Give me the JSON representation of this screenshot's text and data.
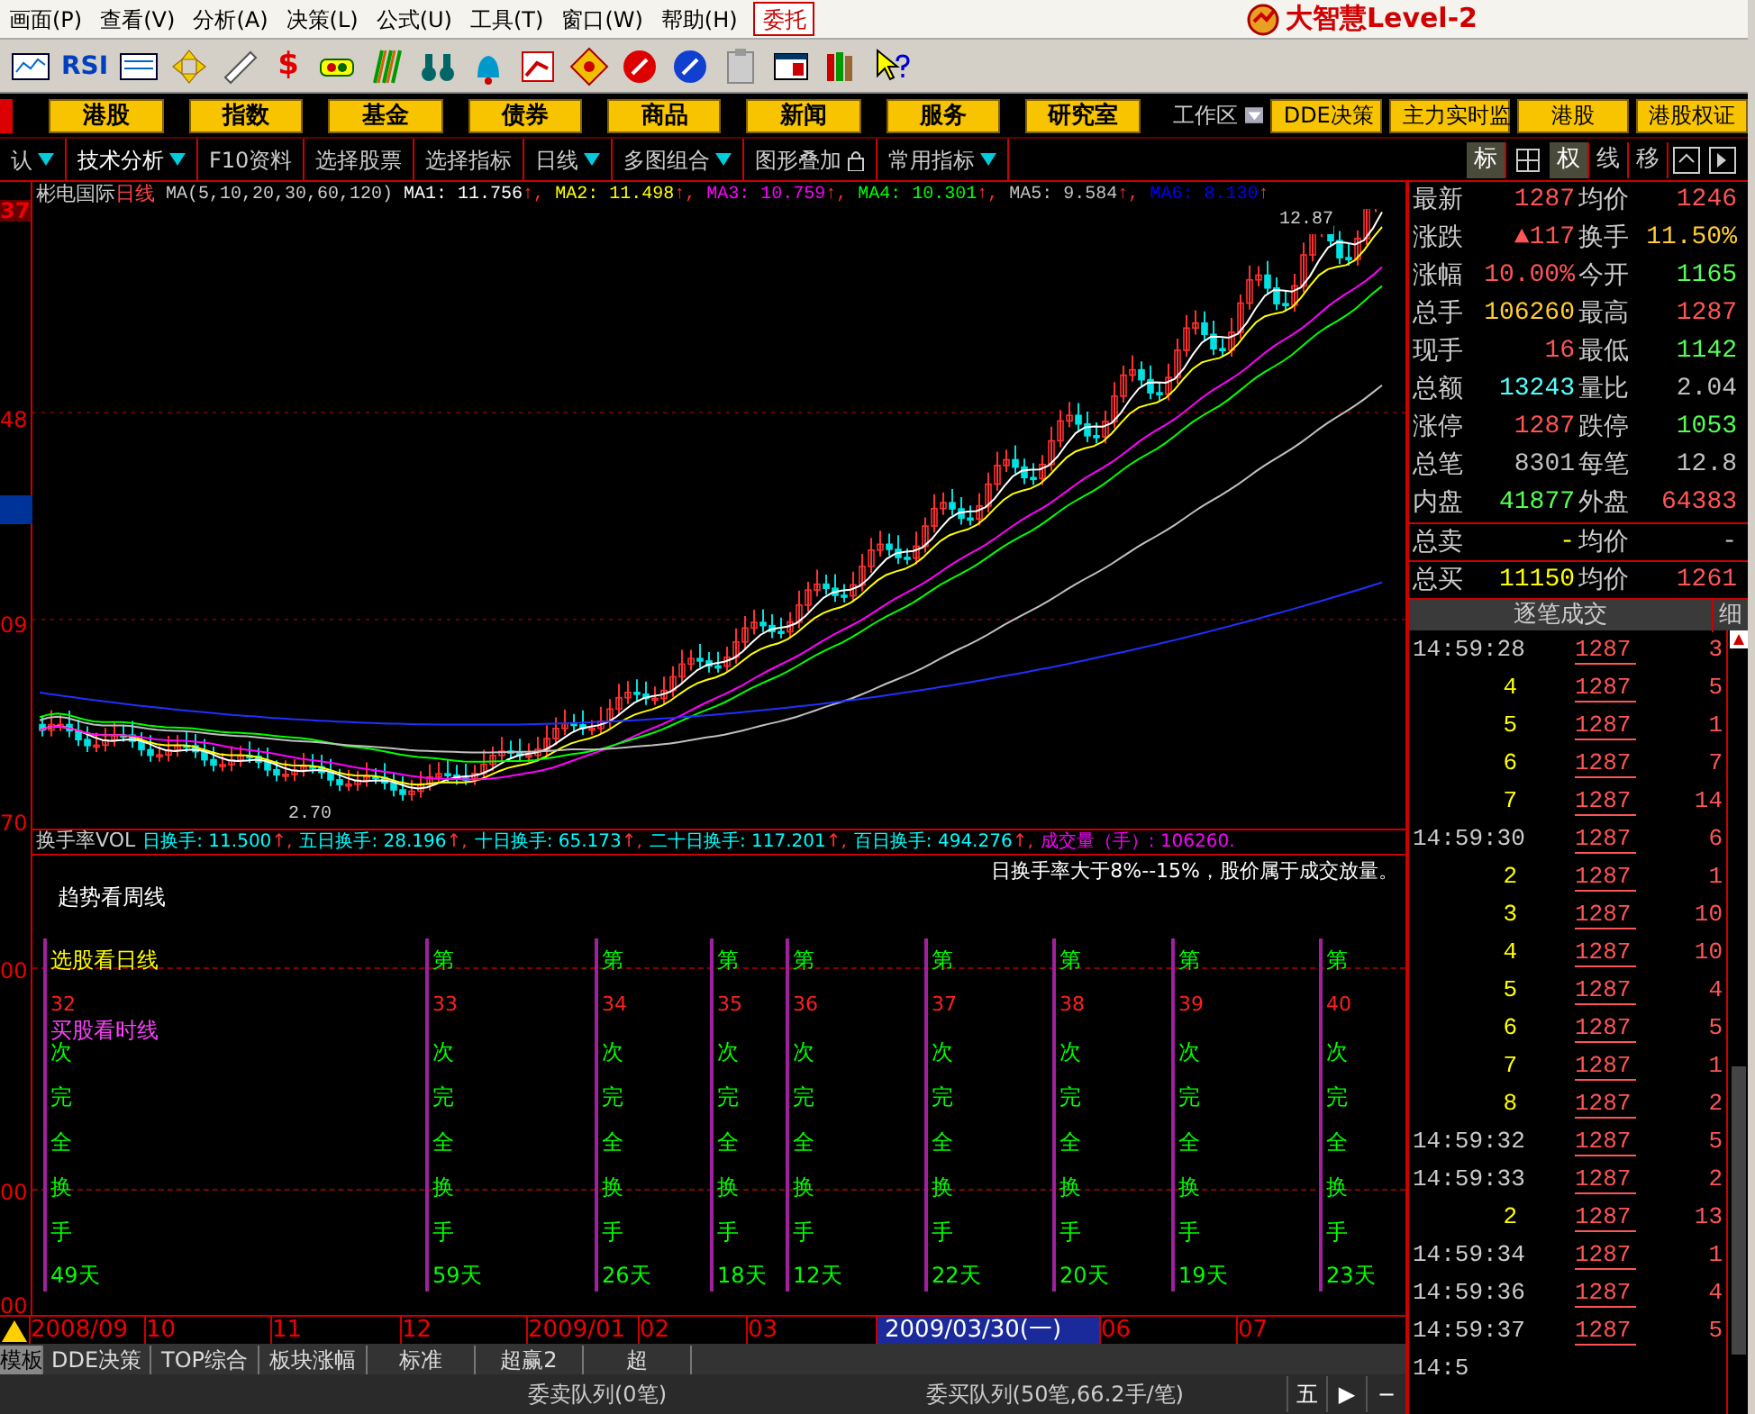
{
  "menu": [
    {
      "label": "画面(P)"
    },
    {
      "label": "查看(V)"
    },
    {
      "label": "分析(A)"
    },
    {
      "label": "决策(L)"
    },
    {
      "label": "公式(U)"
    },
    {
      "label": "工具(T)"
    },
    {
      "label": "窗口(W)"
    },
    {
      "label": "帮助(H)"
    }
  ],
  "trade_button": "委托",
  "brand": "大智慧Level-2",
  "toolbar": {
    "rsi_label": "RSI",
    "dollar_label": "$"
  },
  "nav_buttons": [
    "港股",
    "指数",
    "基金",
    "债券",
    "商品",
    "新闻",
    "服务",
    "研究室"
  ],
  "workspace": "工作区",
  "nav_right": [
    "DDE决策",
    "主力实时监",
    "港股",
    "港股权证"
  ],
  "tool_tabs": [
    {
      "label": "认",
      "dropdown": true
    },
    {
      "label": "技术分析",
      "dropdown": true
    },
    {
      "label": "F10资料",
      "dropdown": false
    },
    {
      "label": "选择股票",
      "dropdown": false
    },
    {
      "label": "选择指标",
      "dropdown": false
    },
    {
      "label": "日线",
      "dropdown": true
    },
    {
      "label": "多图组合",
      "dropdown": true
    },
    {
      "label": "图形叠加",
      "dropdown": false
    },
    {
      "label": "常用指标",
      "dropdown": true
    }
  ],
  "view_buttons": [
    {
      "label": "标",
      "selected": true
    },
    {
      "label": "权",
      "selected": true
    },
    {
      "label": "线",
      "selected": false
    },
    {
      "label": "移",
      "selected": false
    }
  ],
  "chart": {
    "stock": "彬电国际",
    "period": "日线",
    "ma_params": "MA(5,10,20,30,60,120)",
    "ma": [
      {
        "label": "MA1: 11.756",
        "suffix": "↑,",
        "color": "#ffffff"
      },
      {
        "label": "MA2: 11.498",
        "suffix": "↑,",
        "color": "#ffff00"
      },
      {
        "label": "MA3: 10.759",
        "suffix": "↑,",
        "color": "#ff00ff"
      },
      {
        "label": "MA4: 10.301",
        "suffix": "↑,",
        "color": "#00ff00"
      },
      {
        "label": "MA5: 9.584",
        "suffix": "↑,",
        "color": "#c0c0c0"
      },
      {
        "label": "MA6: 8.130",
        "suffix": "↑",
        "color": "#0000ff"
      }
    ],
    "high_label": "12.87",
    "low_label": "2.70",
    "axis_labels": [
      "37",
      "48",
      "09",
      "70"
    ]
  },
  "indicator": {
    "name": "换手率VOL",
    "values": [
      {
        "label": "日换手: 11.500",
        "suffix": "↑,",
        "color": "#00ffff"
      },
      {
        "label": "五日换手: 28.196",
        "suffix": "↑,",
        "color": "#00ffff"
      },
      {
        "label": "十日换手: 65.173",
        "suffix": "↑,",
        "color": "#00ffff"
      },
      {
        "label": "二十日换手: 117.201",
        "suffix": "↑,",
        "color": "#00ffff"
      },
      {
        "label": "百日换手: 494.276",
        "suffix": "↑,",
        "color": "#00ffff"
      },
      {
        "label": "成交量（手）: 106260.",
        "color": "#ff00ff"
      }
    ],
    "note": "日换手率大于8%--15%，股价属于成交放量。",
    "trend": "趋势看周线",
    "axis_labels": [
      "00",
      "00",
      "00"
    ],
    "columns": [
      {
        "head": "选股看日线",
        "num": "32",
        "sub": "买股看时线",
        "chars": [
          "次",
          "完",
          "全",
          "换",
          "手"
        ],
        "days": "49天"
      },
      {
        "head": "第",
        "num": "33",
        "chars": [
          "次",
          "完",
          "全",
          "换",
          "手"
        ],
        "days": "59天"
      },
      {
        "head": "第",
        "num": "34",
        "chars": [
          "次",
          "完",
          "全",
          "换",
          "手"
        ],
        "days": "26天"
      },
      {
        "head": "第",
        "num": "35",
        "chars": [
          "次",
          "完",
          "全",
          "换",
          "手"
        ],
        "days": "18天"
      },
      {
        "head": "第",
        "num": "36",
        "chars": [
          "次",
          "完",
          "全",
          "换",
          "手"
        ],
        "days": "12天"
      },
      {
        "head": "第",
        "num": "37",
        "chars": [
          "次",
          "完",
          "全",
          "换",
          "手"
        ],
        "days": "22天"
      },
      {
        "head": "第",
        "num": "38",
        "chars": [
          "次",
          "完",
          "全",
          "换",
          "手"
        ],
        "days": "20天"
      },
      {
        "head": "第",
        "num": "39",
        "chars": [
          "次",
          "完",
          "全",
          "换",
          "手"
        ],
        "days": "19天"
      },
      {
        "head": "第",
        "num": "40",
        "chars": [
          "次",
          "完",
          "全",
          "换",
          "手"
        ],
        "days": "23天"
      }
    ]
  },
  "dates": [
    {
      "label": "2008/09",
      "selected": false
    },
    {
      "label": "10",
      "selected": false
    },
    {
      "label": "11",
      "selected": false
    },
    {
      "label": "12",
      "selected": false
    },
    {
      "label": "2009/01",
      "selected": false
    },
    {
      "label": "02",
      "selected": false
    },
    {
      "label": "03",
      "selected": false
    },
    {
      "label": "2009/03/30(一)",
      "selected": true
    },
    {
      "label": "06",
      "selected": false
    },
    {
      "label": "07",
      "selected": false
    }
  ],
  "bottom_tabs": [
    {
      "label": "模板",
      "selected": true
    },
    {
      "label": "DDE决策",
      "selected": false
    },
    {
      "label": "TOP综合",
      "selected": false
    },
    {
      "label": "板块涨幅",
      "selected": false
    },
    {
      "label": "标准",
      "selected": false
    },
    {
      "label": "超赢2",
      "selected": false
    },
    {
      "label": "超",
      "selected": false
    }
  ],
  "status": {
    "sell_queue": "委卖队列(0笔)",
    "buy_queue": "委买队列(50笔,66.2手/笔)",
    "five": "五",
    "play": "▶",
    "minus": "−"
  },
  "quote": [
    {
      "cells": [
        {
          "label": "最新",
          "value": "1287",
          "color": "#ff5555"
        },
        {
          "label": "均价",
          "value": "1246",
          "color": "#ff5555"
        }
      ]
    },
    {
      "cells": [
        {
          "label": "涨跌",
          "value": "▲117",
          "color": "#ff5555"
        },
        {
          "label": "换手",
          "value": "11.50%",
          "color": "#ffcc33"
        }
      ]
    },
    {
      "cells": [
        {
          "label": "涨幅",
          "value": "10.00%",
          "color": "#ff5555"
        },
        {
          "label": "今开",
          "value": "1165",
          "color": "#55ff55"
        }
      ]
    },
    {
      "cells": [
        {
          "label": "总手",
          "value": "106260",
          "color": "#ffcc33"
        },
        {
          "label": "最高",
          "value": "1287",
          "color": "#ff5555"
        }
      ]
    },
    {
      "cells": [
        {
          "label": "现手",
          "value": "16",
          "color": "#ff5555"
        },
        {
          "label": "最低",
          "value": "1142",
          "color": "#55ff55"
        }
      ]
    },
    {
      "cells": [
        {
          "label": "总额",
          "value": "13243",
          "color": "#55ffff"
        },
        {
          "label": "量比",
          "value": "2.04",
          "color": "#c0c0c0"
        }
      ]
    },
    {
      "cells": [
        {
          "label": "涨停",
          "value": "1287",
          "color": "#ff5555"
        },
        {
          "label": "跌停",
          "value": "1053",
          "color": "#55ff55"
        }
      ]
    },
    {
      "cells": [
        {
          "label": "总笔",
          "value": "8301",
          "color": "#c0c0c0"
        },
        {
          "label": "每笔",
          "value": "12.8",
          "color": "#c0c0c0"
        }
      ]
    },
    {
      "cells": [
        {
          "label": "内盘",
          "value": "41877",
          "color": "#55ff55"
        },
        {
          "label": "外盘",
          "value": "64383",
          "color": "#ff5555"
        }
      ]
    },
    {
      "cells": [
        {
          "label": "总卖",
          "value": "-",
          "color": "#ffff00"
        },
        {
          "label": "均价",
          "value": "-",
          "color": "#c0c0c0"
        }
      ]
    },
    {
      "cells": [
        {
          "label": "总买",
          "value": "11150",
          "color": "#ffff00"
        },
        {
          "label": "均价",
          "value": "1261",
          "color": "#ff5555"
        }
      ]
    }
  ],
  "trades_title": "逐笔成交",
  "trades_detail": "细",
  "trades": [
    {
      "time": "14:59:28",
      "full": true,
      "price": "1287",
      "vol": "3"
    },
    {
      "time": "4",
      "full": false,
      "price": "1287",
      "vol": "5"
    },
    {
      "time": "5",
      "full": false,
      "price": "1287",
      "vol": "1"
    },
    {
      "time": "6",
      "full": false,
      "price": "1287",
      "vol": "7"
    },
    {
      "time": "7",
      "full": false,
      "price": "1287",
      "vol": "14"
    },
    {
      "time": "14:59:30",
      "full": true,
      "price": "1287",
      "vol": "6"
    },
    {
      "time": "2",
      "full": false,
      "price": "1287",
      "vol": "1"
    },
    {
      "time": "3",
      "full": false,
      "price": "1287",
      "vol": "10"
    },
    {
      "time": "4",
      "full": false,
      "price": "1287",
      "vol": "10"
    },
    {
      "time": "5",
      "full": false,
      "price": "1287",
      "vol": "4"
    },
    {
      "time": "6",
      "full": false,
      "price": "1287",
      "vol": "5"
    },
    {
      "time": "7",
      "full": false,
      "price": "1287",
      "vol": "1"
    },
    {
      "time": "8",
      "full": false,
      "price": "1287",
      "vol": "2"
    },
    {
      "time": "14:59:32",
      "full": true,
      "price": "1287",
      "vol": "5"
    },
    {
      "time": "14:59:33",
      "full": true,
      "price": "1287",
      "vol": "2"
    },
    {
      "time": "2",
      "full": false,
      "price": "1287",
      "vol": "13"
    },
    {
      "time": "14:59:34",
      "full": true,
      "price": "1287",
      "vol": "1"
    },
    {
      "time": "14:59:36",
      "full": true,
      "price": "1287",
      "vol": "4"
    },
    {
      "time": "14:59:37",
      "full": true,
      "price": "1287",
      "vol": "5"
    },
    {
      "time": "14:5",
      "full": true
    }
  ]
}
